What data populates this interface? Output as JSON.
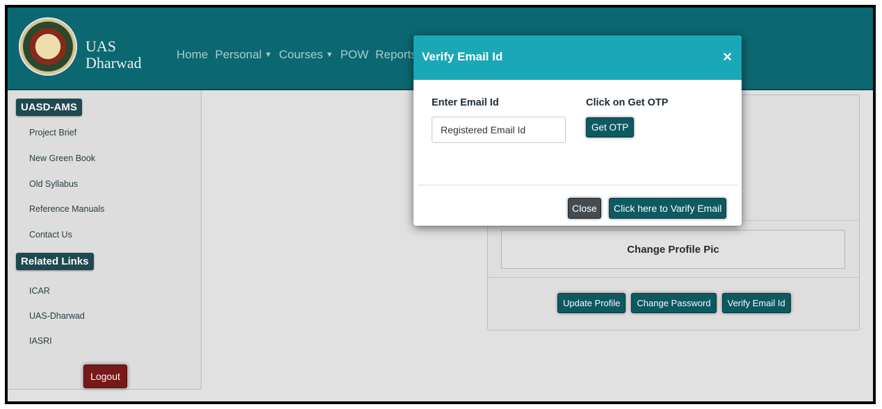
{
  "header": {
    "brand_line1": "UAS",
    "brand_line2": "Dharwad",
    "nav": [
      "Home",
      "Personal",
      "Courses",
      "POW",
      "Reports"
    ]
  },
  "sidebar": {
    "section1": "UASD-AMS",
    "links1": [
      "Project Brief",
      "New Green Book",
      "Old Syllabus",
      "Reference Manuals",
      "Contact Us"
    ],
    "section2": "Related Links",
    "links2": [
      "ICAR",
      "UAS-Dharwad",
      "IASRI"
    ],
    "logout": "Logout"
  },
  "card": {
    "change_pic": "Change Profile Pic",
    "buttons": [
      "Update Profile",
      "Change Password",
      "Verify Email Id"
    ]
  },
  "modal": {
    "title": "Verify Email Id",
    "close_glyph": "×",
    "email_label": "Enter Email Id",
    "email_placeholder": "Registered Email Id",
    "otp_label": "Click on Get OTP",
    "otp_button": "Get OTP",
    "close_button": "Close",
    "verify_button": "Click here to Varify Email"
  },
  "colors": {
    "navbar": "#0d6b73",
    "modal_header": "#1aa8b6",
    "button": "#0f5a62",
    "logout": "#7a1a1a"
  }
}
